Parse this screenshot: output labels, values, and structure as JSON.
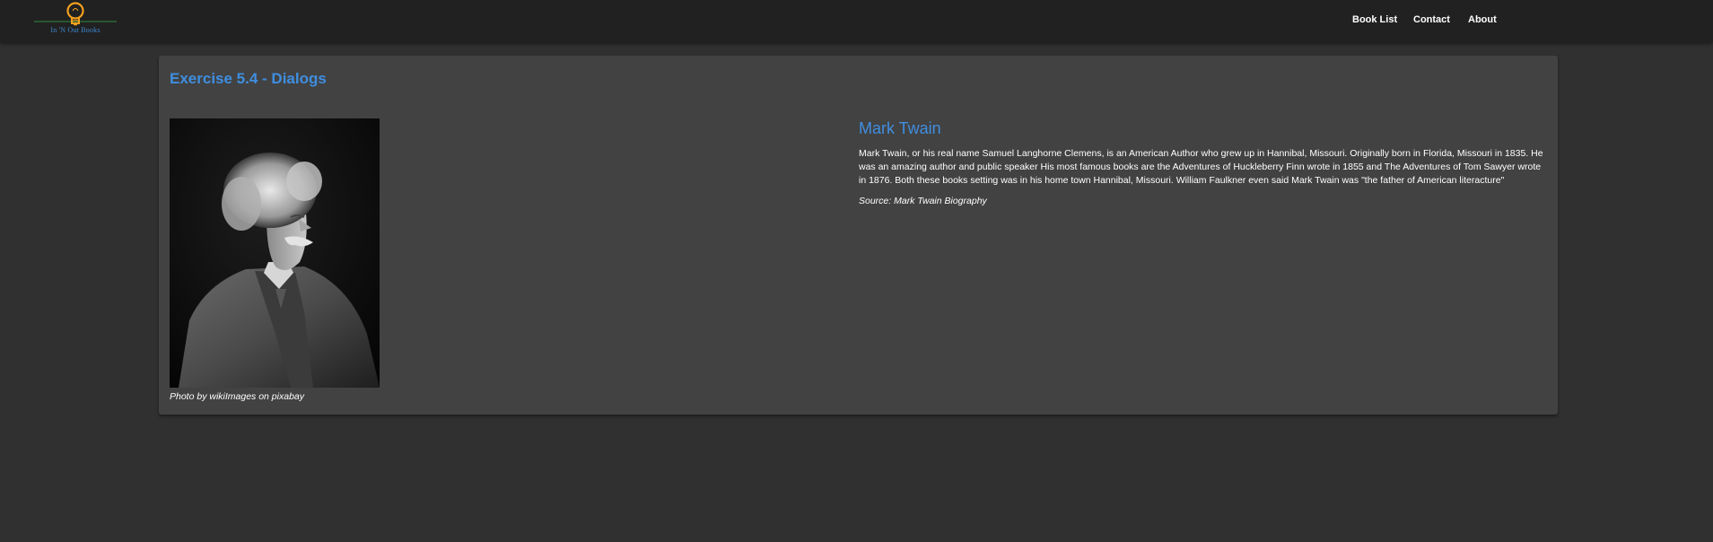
{
  "header": {
    "logo_text": "In 'N Out Books",
    "nav": {
      "book_list": "Book List",
      "contact": "Contact",
      "about": "About"
    },
    "colors": {
      "bar": "#212121",
      "logo_bulb": "#f4a11d",
      "logo_line": "#2e8b3e",
      "logo_text": "#3f88cf"
    }
  },
  "card": {
    "title": "Exercise 5.4 - Dialogs",
    "photo_caption": "Photo by wikiImages on pixabay",
    "author": {
      "name": "Mark Twain",
      "bio": "Mark Twain, or his real name Samuel Langhorne Clemens, is an American Author who grew up in Hannibal, Missouri. Originally born in Florida, Missouri in 1835. He was an amazing author and public speaker His most famous books are the Adventures of Huckleberry Finn wrote in 1855 and The Adventures of Tom Sawyer wrote in 1876. Both these books setting was in his home town Hannibal, Missouri. William Faulkner even said Mark Twain was \"the father of American literacture\"",
      "source": "Source: Mark Twain Biography"
    },
    "colors": {
      "accent": "#3f8ee0",
      "background": "#424242"
    }
  },
  "page": {
    "background": "#303030"
  }
}
